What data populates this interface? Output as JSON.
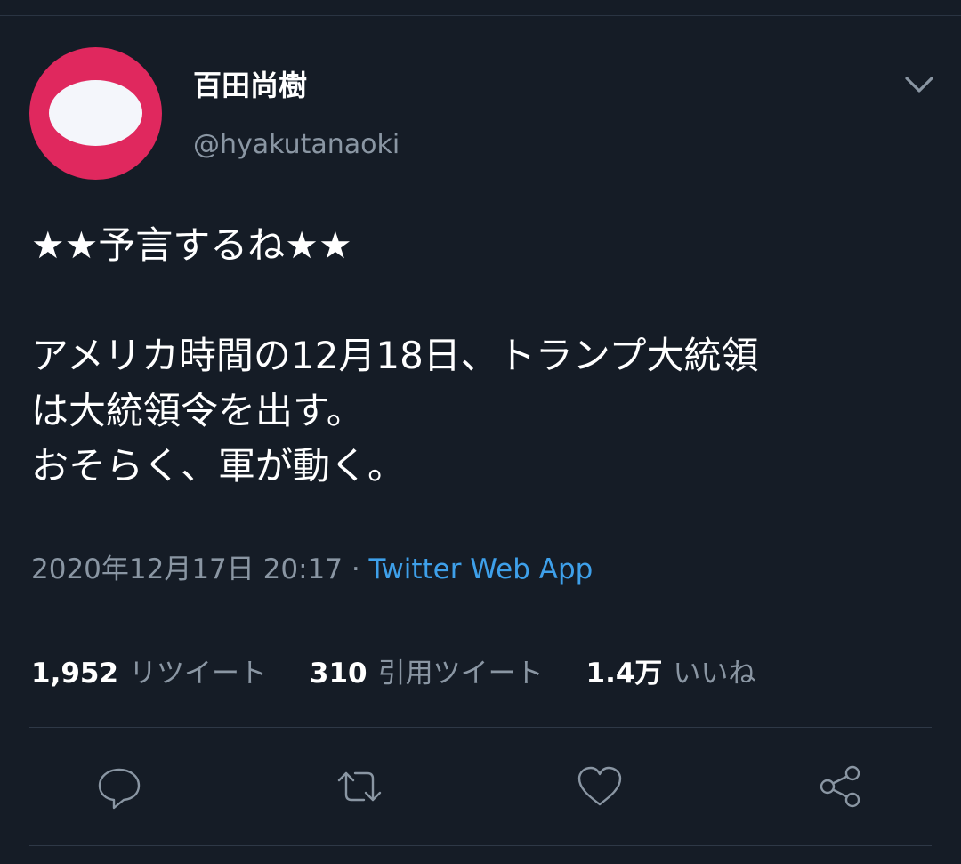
{
  "author": {
    "display_name": "百田尚樹",
    "handle": "@hyakutanaoki"
  },
  "tweet": {
    "lines": [
      "★★予言するね★★",
      "",
      "アメリカ時間の12月18日、トランプ大統領",
      "は大統領令を出す。",
      "おそらく、軍が動く。"
    ],
    "timestamp": "2020年12月17日 20:17",
    "separator": " · ",
    "source": "Twitter Web App"
  },
  "stats": {
    "retweets_count": "1,952",
    "retweets_label": "リツイート",
    "quotes_count": "310",
    "quotes_label": "引用ツイート",
    "likes_count": "1.4万",
    "likes_label": "いいね"
  },
  "colors": {
    "background": "#151c26",
    "avatar": "#e0285e",
    "secondary_text": "#8a96a3",
    "link": "#3ea0ea"
  },
  "icons": {
    "more": "chevron-down-icon",
    "reply": "reply-icon",
    "retweet": "retweet-icon",
    "like": "heart-icon",
    "share": "share-icon"
  }
}
